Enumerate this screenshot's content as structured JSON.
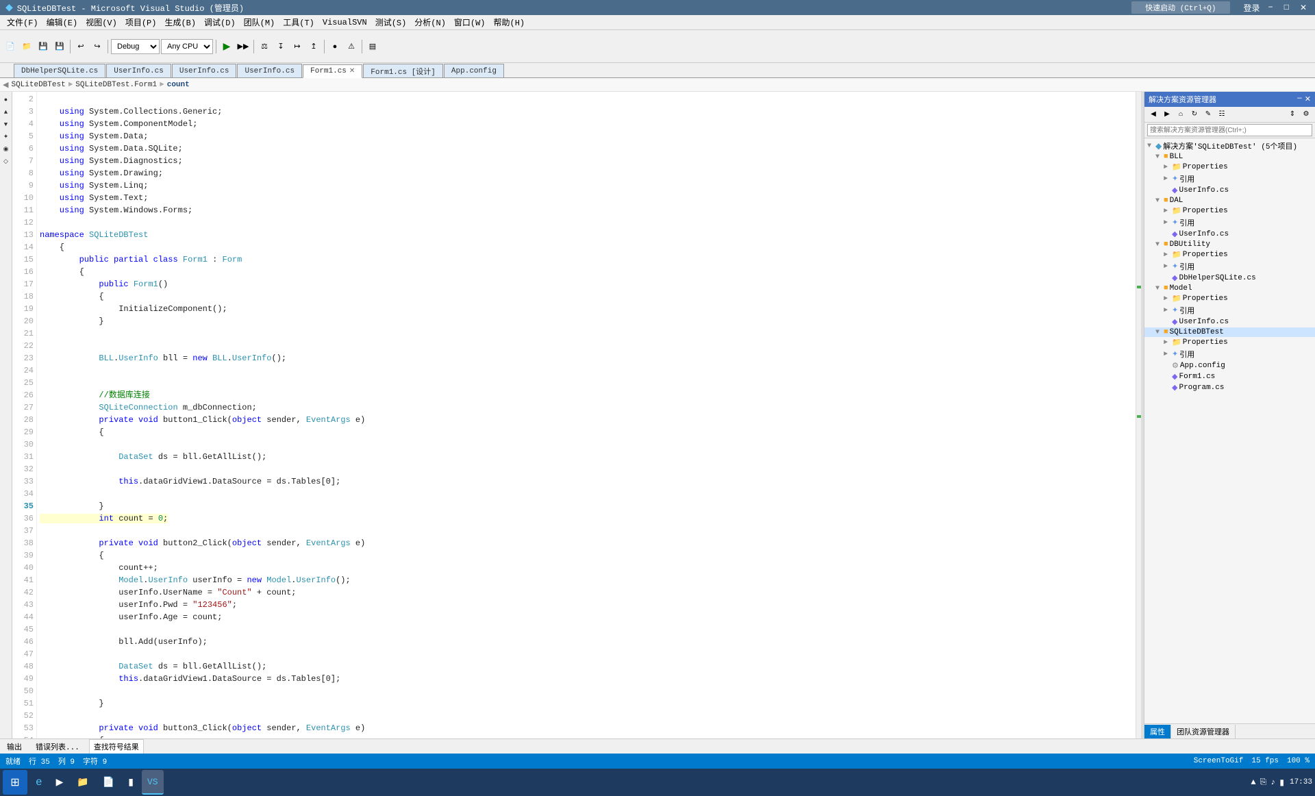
{
  "titleBar": {
    "title": "SQLiteDBTest - Microsoft Visual Studio (管理员)",
    "icon": "vs-icon"
  },
  "menuBar": {
    "items": [
      "文件(F)",
      "编辑(E)",
      "视图(V)",
      "项目(P)",
      "生成(B)",
      "调试(D)",
      "团队(M)",
      "工具(T)",
      "VisualSVN",
      "测试(S)",
      "分析(N)",
      "窗口(W)",
      "帮助(H)"
    ]
  },
  "toolbar": {
    "debugMode": "Debug",
    "platform": "Any CPU",
    "quickLaunch": "快速启动 (Ctrl+Q)"
  },
  "tabs": [
    {
      "label": "DbHelperSQLite.cs",
      "active": false,
      "closable": false
    },
    {
      "label": "UserInfo.cs",
      "active": false,
      "closable": false
    },
    {
      "label": "UserInfo.cs",
      "active": false,
      "closable": false
    },
    {
      "label": "UserInfo.cs",
      "active": false,
      "closable": false
    },
    {
      "label": "Form1.cs",
      "active": true,
      "closable": true
    },
    {
      "label": "Form1.cs [设计]",
      "active": false,
      "closable": false
    },
    {
      "label": "App.config",
      "active": false,
      "closable": false
    }
  ],
  "breadcrumb": {
    "project": "SQLiteDBTest",
    "namespace": "SQLiteDBTest.Form1",
    "member": "count"
  },
  "code": {
    "lines": [
      {
        "num": 2,
        "text": "    using System.Collections.Generic;"
      },
      {
        "num": 3,
        "text": "    using System.ComponentModel;"
      },
      {
        "num": 4,
        "text": "    using System.Data;"
      },
      {
        "num": 5,
        "text": "    using System.Data.SQLite;"
      },
      {
        "num": 6,
        "text": "    using System.Diagnostics;"
      },
      {
        "num": 7,
        "text": "    using System.Drawing;"
      },
      {
        "num": 8,
        "text": "    using System.Linq;"
      },
      {
        "num": 9,
        "text": "    using System.Text;"
      },
      {
        "num": 10,
        "text": "    using System.Windows.Forms;"
      },
      {
        "num": 11,
        "text": ""
      },
      {
        "num": 12,
        "text": "namespace SQLiteDBTest"
      },
      {
        "num": 13,
        "text": "    {"
      },
      {
        "num": 14,
        "text": "        public partial class Form1 : Form"
      },
      {
        "num": 15,
        "text": "        {"
      },
      {
        "num": 16,
        "text": "            public Form1()"
      },
      {
        "num": 17,
        "text": "            {"
      },
      {
        "num": 18,
        "text": "                InitializeComponent();"
      },
      {
        "num": 19,
        "text": "            }"
      },
      {
        "num": 20,
        "text": ""
      },
      {
        "num": 21,
        "text": ""
      },
      {
        "num": 22,
        "text": "            BLL.UserInfo bll = new BLL.UserInfo();"
      },
      {
        "num": 23,
        "text": ""
      },
      {
        "num": 24,
        "text": ""
      },
      {
        "num": 25,
        "text": "            //数据库连接"
      },
      {
        "num": 26,
        "text": "            SQLiteConnection m_dbConnection;"
      },
      {
        "num": 27,
        "text": "            private void button1_Click(object sender, EventArgs e)"
      },
      {
        "num": 28,
        "text": "            {"
      },
      {
        "num": 29,
        "text": ""
      },
      {
        "num": 30,
        "text": "                DataSet ds = bll.GetAllList();"
      },
      {
        "num": 31,
        "text": ""
      },
      {
        "num": 32,
        "text": "                this.dataGridView1.DataSource = ds.Tables[0];"
      },
      {
        "num": 33,
        "text": ""
      },
      {
        "num": 34,
        "text": "            }"
      },
      {
        "num": 35,
        "text": "            int count = 0;",
        "highlight": true
      },
      {
        "num": 36,
        "text": ""
      },
      {
        "num": 37,
        "text": "            private void button2_Click(object sender, EventArgs e)"
      },
      {
        "num": 38,
        "text": "            {"
      },
      {
        "num": 39,
        "text": "                count++;"
      },
      {
        "num": 40,
        "text": "                Model.UserInfo userInfo = new Model.UserInfo();"
      },
      {
        "num": 41,
        "text": "                userInfo.UserName = \"Count\" + count;"
      },
      {
        "num": 42,
        "text": "                userInfo.Pwd = \"123456\";"
      },
      {
        "num": 43,
        "text": "                userInfo.Age = count;"
      },
      {
        "num": 44,
        "text": ""
      },
      {
        "num": 45,
        "text": "                bll.Add(userInfo);"
      },
      {
        "num": 46,
        "text": ""
      },
      {
        "num": 47,
        "text": "                DataSet ds = bll.GetAllList();"
      },
      {
        "num": 48,
        "text": "                this.dataGridView1.DataSource = ds.Tables[0];"
      },
      {
        "num": 49,
        "text": ""
      },
      {
        "num": 50,
        "text": "            }"
      },
      {
        "num": 51,
        "text": ""
      },
      {
        "num": 52,
        "text": "            private void button3_Click(object sender, EventArgs e)"
      },
      {
        "num": 53,
        "text": "            {"
      },
      {
        "num": 54,
        "text": ""
      }
    ]
  },
  "sidebar": {
    "title": "解决方案资源管理器",
    "solutionLabel": "解决方案'SQLiteDBTest' (5个项目)",
    "searchPlaceholder": "搜索解决方案资源管理器(Ctrl+;)",
    "tree": [
      {
        "level": 0,
        "label": "BLL",
        "type": "project",
        "expanded": true
      },
      {
        "level": 1,
        "label": "Properties",
        "type": "folder"
      },
      {
        "level": 1,
        "label": "引用",
        "type": "ref",
        "prefix": "■■"
      },
      {
        "level": 1,
        "label": "UserInfo.cs",
        "type": "cs",
        "prefix": "◆"
      },
      {
        "level": 0,
        "label": "DAL",
        "type": "project",
        "expanded": true
      },
      {
        "level": 1,
        "label": "Properties",
        "type": "folder"
      },
      {
        "level": 1,
        "label": "引用",
        "type": "ref",
        "prefix": "■■"
      },
      {
        "level": 1,
        "label": "UserInfo.cs",
        "type": "cs",
        "prefix": "◆"
      },
      {
        "level": 0,
        "label": "DBUtility",
        "type": "project",
        "expanded": true
      },
      {
        "level": 1,
        "label": "Properties",
        "type": "folder"
      },
      {
        "level": 1,
        "label": "引用",
        "type": "ref",
        "prefix": "■■"
      },
      {
        "level": 1,
        "label": "DbHelperSQLite.cs",
        "type": "cs",
        "prefix": "◆"
      },
      {
        "level": 0,
        "label": "Model",
        "type": "project",
        "expanded": true
      },
      {
        "level": 1,
        "label": "Properties",
        "type": "folder"
      },
      {
        "level": 1,
        "label": "引用",
        "type": "ref",
        "prefix": "■■"
      },
      {
        "level": 1,
        "label": "UserInfo.cs",
        "type": "cs",
        "prefix": "◆"
      },
      {
        "level": 0,
        "label": "SQLiteDBTest",
        "type": "project",
        "expanded": true,
        "selected": true
      },
      {
        "level": 1,
        "label": "Properties",
        "type": "folder"
      },
      {
        "level": 1,
        "label": "引用",
        "type": "ref",
        "prefix": "■■"
      },
      {
        "level": 1,
        "label": "App.config",
        "type": "config",
        "prefix": "⚙"
      },
      {
        "level": 1,
        "label": "Form1.cs",
        "type": "cs",
        "prefix": "◆"
      },
      {
        "level": 1,
        "label": "Program.cs",
        "type": "cs",
        "prefix": "◆"
      }
    ],
    "bottomTabs": [
      "属性",
      "团队资源管理器"
    ]
  },
  "bottomTabs": {
    "items": [
      "输出",
      "错误列表...",
      "查找符号结果"
    ]
  },
  "statusBar": {
    "status": "就绪",
    "row": "行 35",
    "col": "列 9",
    "char": "字符 9",
    "fps": "15",
    "fpsLabel": "fps",
    "screenToGif": "ScreenToGif",
    "time": "17:33",
    "zoomLevel": "100 %"
  },
  "taskbar": {
    "apps": [
      {
        "label": "开始",
        "icon": "start-icon"
      },
      {
        "label": "IE",
        "icon": "ie-icon"
      },
      {
        "label": "Chrome",
        "icon": "chrome-icon"
      },
      {
        "label": "Explorer",
        "icon": "explorer-icon"
      },
      {
        "label": "Notepad",
        "icon": "notepad-icon"
      },
      {
        "label": "Terminal",
        "icon": "terminal-icon"
      }
    ],
    "activeApp": "Visual Studio"
  }
}
